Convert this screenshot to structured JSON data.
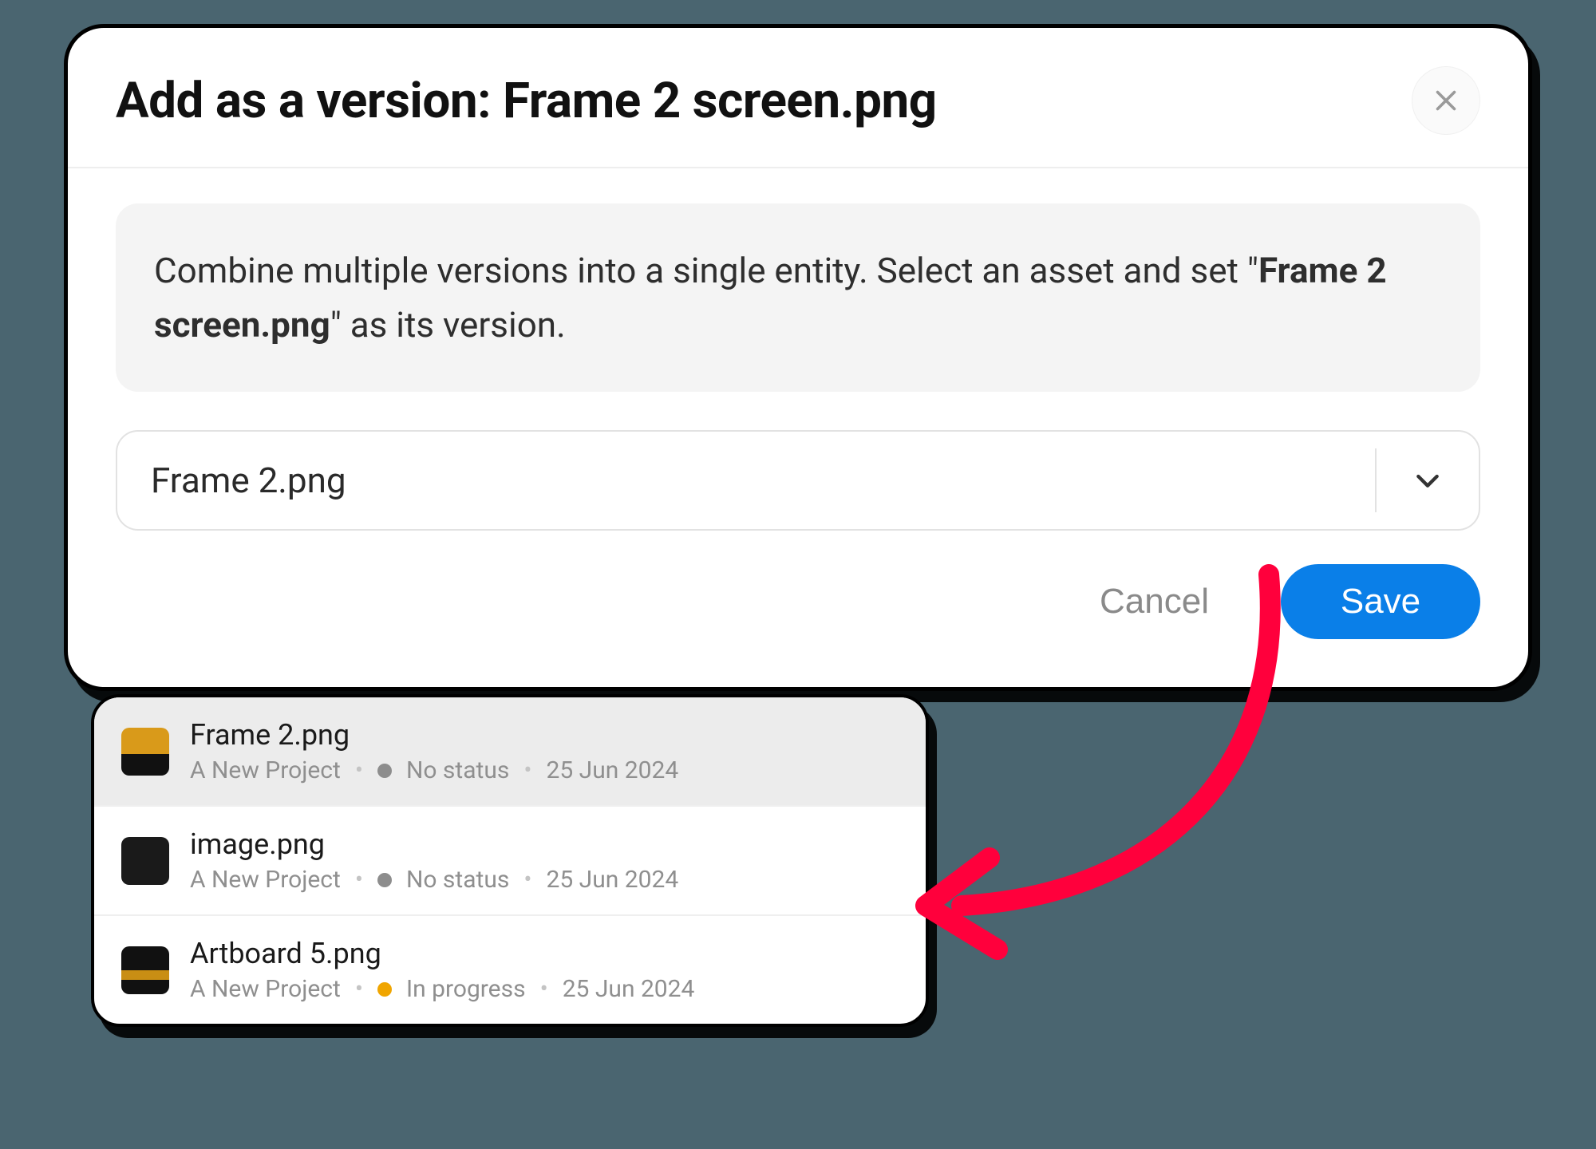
{
  "dialog": {
    "title": "Add as a version: Frame 2 screen.png",
    "info_prefix": "Combine multiple versions into a single entity. Select an asset and set \"",
    "info_filename": "Frame 2 screen.png",
    "info_suffix": "\" as its version."
  },
  "select": {
    "value": "Frame 2.png"
  },
  "actions": {
    "cancel": "Cancel",
    "save": "Save"
  },
  "dropdown": {
    "items": [
      {
        "name": "Frame 2.png",
        "project": "A New Project",
        "status_label": "No status",
        "status_kind": "none",
        "date": "25 Jun 2024",
        "selected": true,
        "thumb": "t0"
      },
      {
        "name": "image.png",
        "project": "A New Project",
        "status_label": "No status",
        "status_kind": "none",
        "date": "25 Jun 2024",
        "selected": false,
        "thumb": "t1"
      },
      {
        "name": "Artboard 5.png",
        "project": "A New Project",
        "status_label": "In progress",
        "status_kind": "progress",
        "date": "25 Jun 2024",
        "selected": false,
        "thumb": "t2"
      }
    ]
  },
  "annotation": {
    "arrow_color": "#ff003c"
  }
}
